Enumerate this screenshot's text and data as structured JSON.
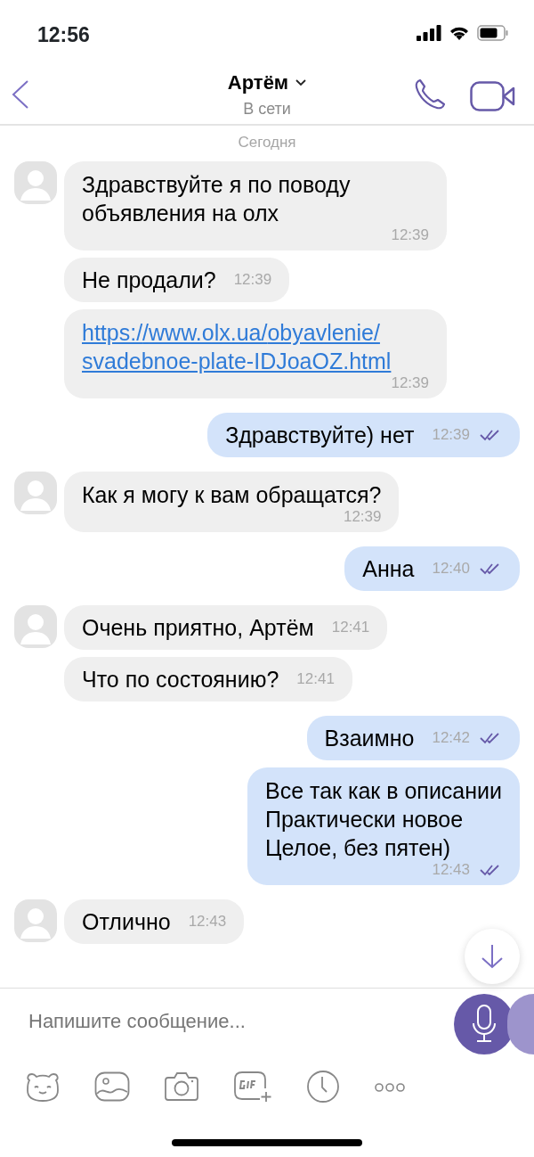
{
  "status_bar": {
    "time": "12:56"
  },
  "header": {
    "contact_name": "Артём",
    "presence": "В сети"
  },
  "date_label": "Сегодня",
  "messages": [
    {
      "outgoing": false,
      "avatar": true,
      "kind": "long",
      "text": "Здравствуйте я по поводу объявления на олх",
      "time": "12:39"
    },
    {
      "outgoing": false,
      "avatar": false,
      "kind": "short",
      "text": "Не продали?",
      "time": "12:39"
    },
    {
      "outgoing": false,
      "avatar": false,
      "kind": "link",
      "text": "https://www.olx.ua/obyavlenie/svadebnoe-plate-IDJoaOZ.html",
      "time": "12:39"
    },
    {
      "outgoing": true,
      "kind": "short",
      "text": "Здравствуйте) нет",
      "time": "12:39",
      "read": true
    },
    {
      "outgoing": false,
      "avatar": true,
      "kind": "long",
      "text": "Как я могу к вам обращатся?",
      "time": "12:39"
    },
    {
      "outgoing": true,
      "kind": "short",
      "text": "Анна",
      "time": "12:40",
      "read": true
    },
    {
      "outgoing": false,
      "avatar": true,
      "kind": "short",
      "text": "Очень приятно, Артём",
      "time": "12:41"
    },
    {
      "outgoing": false,
      "avatar": false,
      "kind": "short",
      "text": "Что по состоянию?",
      "time": "12:41"
    },
    {
      "outgoing": true,
      "kind": "short",
      "text": "Взаимно",
      "time": "12:42",
      "read": true
    },
    {
      "outgoing": true,
      "kind": "long",
      "text": "Все так как в описании\nПрактически новое\nЦелое, без пятен)",
      "time": "12:43",
      "read": true
    },
    {
      "outgoing": false,
      "avatar": true,
      "kind": "short",
      "text": "Отлично",
      "time": "12:43"
    }
  ],
  "composer": {
    "placeholder": "Напишите сообщение..."
  }
}
